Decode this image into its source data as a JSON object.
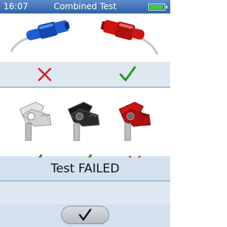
{
  "header": {
    "time": "16:07",
    "title": "Combined Test",
    "battery_icon": "battery-icon",
    "battery_level": 0.9,
    "battery_color": "#2fd23a"
  },
  "probes": [
    {
      "name": "blue-probe-icon",
      "color": "#1e5fd0",
      "result": "fail"
    },
    {
      "name": "red-probe-icon",
      "color": "#d01414",
      "result": "pass"
    }
  ],
  "clips": [
    {
      "name": "white-clip-icon",
      "color": "#e4e4e4",
      "result": "pass"
    },
    {
      "name": "black-clip-icon",
      "color": "#1a1a1a",
      "result": "pass"
    },
    {
      "name": "red-clip-icon",
      "color": "#d01414",
      "result": "fail"
    }
  ],
  "status": {
    "text": "Test FAILED"
  },
  "ok_button": {
    "icon": "checkmark-icon"
  },
  "colors": {
    "pass": "#1f9a1f",
    "fail": "#d42020",
    "header": "#3a6fb5"
  }
}
